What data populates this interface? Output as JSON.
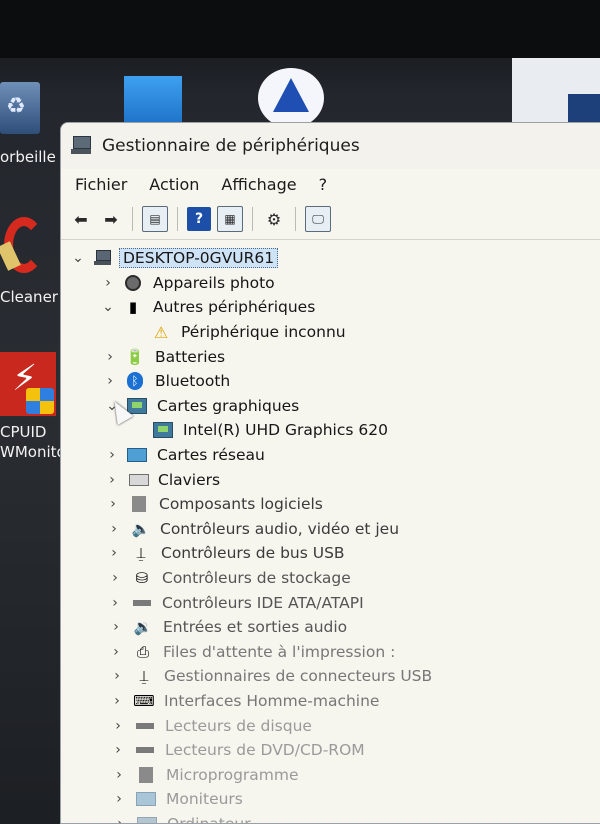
{
  "desktop": {
    "icons": [
      {
        "label": "orbeille",
        "icon": "recycle-bin-icon"
      },
      {
        "label": "Cleaner",
        "icon": "ccleaner-icon"
      },
      {
        "label": "CPUID",
        "label2": "WMonitor",
        "icon": "hwmonitor-icon"
      }
    ]
  },
  "window": {
    "title": "Gestionnaire de périphériques",
    "menu": [
      "Fichier",
      "Action",
      "Affichage",
      "?"
    ],
    "toolbar": [
      "back-arrow-icon",
      "forward-arrow-icon",
      "properties-icon",
      "help-icon",
      "view-icon",
      "update-driver-icon",
      "scan-hardware-icon"
    ]
  },
  "tree": {
    "root": "DESKTOP-0GVUR61",
    "items": [
      {
        "label": "Appareils photo",
        "icon": "camera-icon",
        "state": "collapsed"
      },
      {
        "label": "Autres périphériques",
        "icon": "unknown-device-icon",
        "state": "expanded"
      },
      {
        "label": "Périphérique inconnu",
        "icon": "warning-icon",
        "state": "child"
      },
      {
        "label": "Batteries",
        "icon": "battery-icon",
        "state": "collapsed"
      },
      {
        "label": "Bluetooth",
        "icon": "bluetooth-icon",
        "state": "collapsed"
      },
      {
        "label": "Cartes graphiques",
        "icon": "display-adapter-icon",
        "state": "expanded"
      },
      {
        "label": "Intel(R) UHD Graphics 620",
        "icon": "display-adapter-icon",
        "state": "child"
      },
      {
        "label": "Cartes réseau",
        "icon": "network-adapter-icon",
        "state": "collapsed"
      },
      {
        "label": "Claviers",
        "icon": "keyboard-icon",
        "state": "collapsed"
      },
      {
        "label": "Composants logiciels",
        "icon": "software-component-icon",
        "state": "collapsed"
      },
      {
        "label": "Contrôleurs audio, vidéo et jeu",
        "icon": "audio-icon",
        "state": "collapsed"
      },
      {
        "label": "Contrôleurs de bus USB",
        "icon": "usb-icon",
        "state": "collapsed"
      },
      {
        "label": "Contrôleurs de stockage",
        "icon": "storage-controller-icon",
        "state": "collapsed"
      },
      {
        "label": "Contrôleurs IDE ATA/ATAPI",
        "icon": "ide-controller-icon",
        "state": "collapsed"
      },
      {
        "label": "Entrées et sorties audio",
        "icon": "audio-io-icon",
        "state": "collapsed"
      },
      {
        "label": "Files d'attente à l'impression :",
        "icon": "print-queue-icon",
        "state": "collapsed"
      },
      {
        "label": "Gestionnaires de connecteurs USB",
        "icon": "usb-connector-icon",
        "state": "collapsed"
      },
      {
        "label": "Interfaces Homme-machine",
        "icon": "hid-icon",
        "state": "collapsed"
      },
      {
        "label": "Lecteurs de disque",
        "icon": "disk-drive-icon",
        "state": "collapsed"
      },
      {
        "label": "Lecteurs de DVD/CD-ROM",
        "icon": "dvd-drive-icon",
        "state": "collapsed"
      },
      {
        "label": "Microprogramme",
        "icon": "firmware-icon",
        "state": "collapsed"
      },
      {
        "label": "Moniteurs",
        "icon": "monitor-icon",
        "state": "collapsed"
      },
      {
        "label": "Ordinateur",
        "icon": "computer-icon",
        "state": "collapsed"
      }
    ]
  }
}
